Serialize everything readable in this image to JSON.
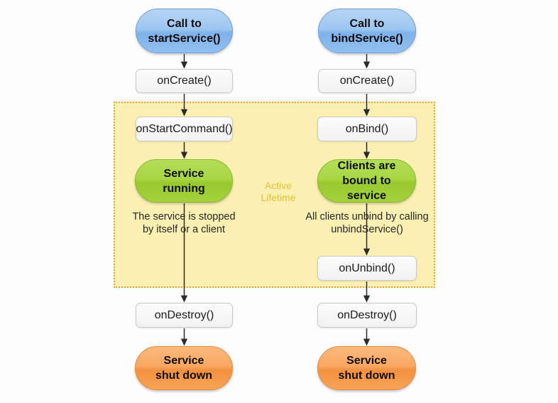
{
  "diagram": {
    "title": "Android Service lifecycle",
    "background_color": "#fdfdfd",
    "active_region": {
      "label": "Active\nLifetime",
      "fill_color": "#fbf0b2",
      "border_color": "#e8a33d",
      "label_color": "#d9c33a"
    },
    "colors": {
      "entry_blue": "#9ec6f1",
      "callback_grey": "#f2f2f2",
      "running_green": "#a8d744",
      "shutdown_orange": "#f9a863"
    }
  },
  "started_column": {
    "entry": "Call to\nstartService()",
    "on_create": "onCreate()",
    "on_start_command": "onStartCommand()",
    "running": "Service\nrunning",
    "stop_caption": "The service is stopped\nby itself or a client",
    "on_destroy": "onDestroy()",
    "shutdown": "Service\nshut down"
  },
  "bound_column": {
    "entry": "Call to\nbindService()",
    "on_create": "onCreate()",
    "on_bind": "onBind()",
    "bound": "Clients are\nbound to\nservice",
    "unbind_caption": "All clients unbind by calling\nunbindService()",
    "on_unbind": "onUnbind()",
    "on_destroy": "onDestroy()",
    "shutdown": "Service\nshut down"
  }
}
